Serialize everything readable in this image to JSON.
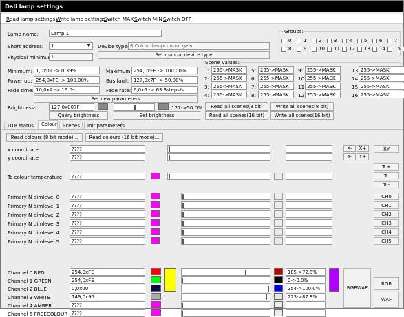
{
  "window_title": "Dali lamp settings",
  "menu": [
    "Read lamp settings",
    "Write lamp settings",
    "Switch MAX",
    "Switch MIN",
    "Switch OFF"
  ],
  "lamp": {
    "name_label": "Lamp name:",
    "name_value": "Lamp 1",
    "short_address_label": "Short address:",
    "short_address_value": "1",
    "device_type_label": "Device type:",
    "device_type_value": "8:Colour lampcontrol gear",
    "set_manual_device_type": "Set manual device type",
    "physical_minimum_label": "Physical minimum:",
    "physical_minimum_value": "1"
  },
  "params": {
    "minimum_label": "Minimum:",
    "minimum_value": "1,0x01 -> 0.39%",
    "maximum_label": "Maximum:",
    "maximum_value": "254,0xFE -> 100.00%",
    "power_up_label": "Power up:",
    "power_up_value": "254,0xFE -> 100.00%",
    "bus_fault_label": "Bus fault:",
    "bus_fault_value": "127,0x7F -> 50.00%",
    "fade_time_label": "Fade time:",
    "fade_time_value": "10,0xA -> 16.0s",
    "fade_rate_label": "Fade rate:",
    "fade_rate_value": "6,0x6 -> 63.3steps/s",
    "set_new_parameters": "Set new parameters"
  },
  "brightness": {
    "label": "Brightness:",
    "hex_value": "127,0x007F",
    "percent_value": "127->50.0%",
    "query_button": "Query brightness",
    "set_button": "Set brightness"
  },
  "groups": {
    "title": "Groups:",
    "items": [
      "0",
      "1",
      "2",
      "3",
      "4",
      "5",
      "6",
      "7",
      "8",
      "9",
      "10",
      "11",
      "12",
      "13",
      "14",
      "15",
      "16"
    ]
  },
  "scenes": {
    "title": "Scene values:",
    "items": [
      {
        "n": "1:",
        "v": "255->MASK"
      },
      {
        "n": "5:",
        "v": "255->MASK"
      },
      {
        "n": "9:",
        "v": "255->MASK"
      },
      {
        "n": "13:",
        "v": "255->MASK"
      },
      {
        "n": "2:",
        "v": "255->MASK"
      },
      {
        "n": "6:",
        "v": "255->MASK"
      },
      {
        "n": "10:",
        "v": "255->MASK"
      },
      {
        "n": "14:",
        "v": "255->MASK"
      },
      {
        "n": "3:",
        "v": "255->MASK"
      },
      {
        "n": "7:",
        "v": "255->MASK"
      },
      {
        "n": "11:",
        "v": "255->MASK"
      },
      {
        "n": "15:",
        "v": "255->MASK"
      },
      {
        "n": "4:",
        "v": "255->MASK"
      },
      {
        "n": "8:",
        "v": "255->MASK"
      },
      {
        "n": "12:",
        "v": "255->MASK"
      },
      {
        "n": "16:",
        "v": "255->MASK"
      }
    ],
    "read_all_8": "Read all scenes(8 bit)",
    "write_all_8": "Write all scenes(8 bit)",
    "read_all_16": "Read all scenes(16 bit)",
    "write_all_16": "Write all scenes(16 bit)"
  },
  "tabs": [
    "DT8 status",
    "Colour",
    "Scenes",
    "Init parameters"
  ],
  "colour": {
    "read8": "Read colours (8 bit mode)...",
    "read16": "Read colours (16 bit mode)...",
    "x_label": "x coordinate",
    "x_value": "????",
    "y_label": "y coordinate",
    "y_value": "????",
    "x_minus": "X-",
    "x_plus": "X+",
    "y_minus": "Y-",
    "y_plus": "Y+",
    "xy_button": "XY",
    "tc_label": "Tc colour temperature",
    "tc_value": "????",
    "tc_plus": "Tc+",
    "tc": "Tc",
    "tc_minus": "Tc-",
    "primary": [
      {
        "label": "Primary N dimlevel 0",
        "value": "????",
        "btn": "CH0"
      },
      {
        "label": "Primary N dimlevel 1",
        "value": "????",
        "btn": "CH1"
      },
      {
        "label": "Primary N dimlevel 2",
        "value": "????",
        "btn": "CH2"
      },
      {
        "label": "Primary N dimlevel 3",
        "value": "????",
        "btn": "CH3"
      },
      {
        "label": "Primary N dimlevel 4",
        "value": "????",
        "btn": "CH4"
      },
      {
        "label": "Primary N dimlevel 5",
        "value": "????",
        "btn": "CH5"
      }
    ],
    "channels": [
      {
        "label": "Channel 0 RED",
        "value": "254,0xFE",
        "color": "#ff0000",
        "out_color": "#c00000",
        "out_value": "185->72.8%"
      },
      {
        "label": "Channel 1 GREEN",
        "value": "254,0xFE",
        "color": "#00ff00",
        "out_color": "#000000",
        "out_value": "0->0.0%"
      },
      {
        "label": "Channel 2 BLUE",
        "value": "0,0x00",
        "color": "#0a0a44",
        "out_color": "#0000ff",
        "out_value": "254->100.0%"
      },
      {
        "label": "Channel 3 WHITE",
        "value": "149,0x95",
        "color": "#aaaaaa",
        "out_color": "#e6e6e6",
        "out_value": "223->87.8%"
      },
      {
        "label": "Channel 4 AMBER",
        "value": "????",
        "color": "#ff00ff",
        "out_color": "",
        "out_value": ""
      },
      {
        "label": "Channel 5 FREECOLOUR",
        "value": "????",
        "color": "#ff00ff",
        "out_color": "",
        "out_value": ""
      }
    ],
    "rgb_button": "RGB",
    "rgbwaf_button": "RGBWAF",
    "waf_button": "WAF"
  }
}
